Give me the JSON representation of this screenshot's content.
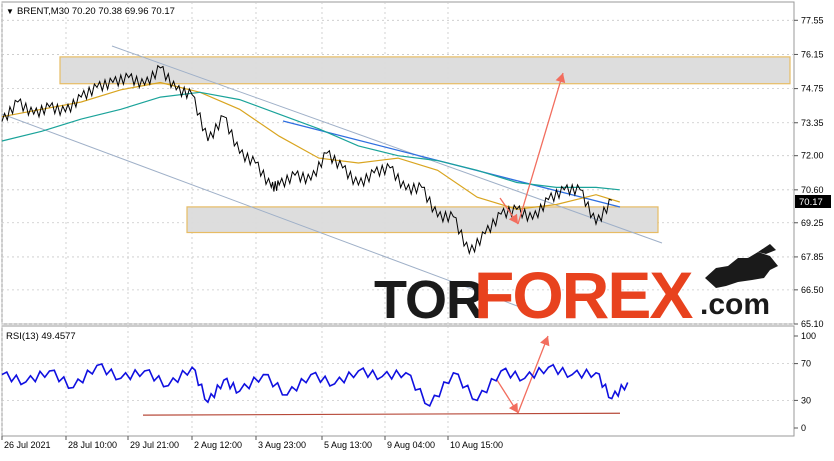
{
  "header": {
    "dropdown_glyph": "▼",
    "symbol_line": "BRENT,M30  70.20 70.38 69.96 70.17"
  },
  "rsi_label": "RSI(13) 49.4577",
  "watermark": {
    "part1": "TOR",
    "part2": "FOREX",
    "part3": ".com",
    "color_dark": "#1a1a1a",
    "color_accent": "#e8421e"
  },
  "colors": {
    "price": "#000000",
    "ma_fast": "#d9a520",
    "ma_slow": "#1aa39a",
    "channel": "#9fb0c8",
    "trend": "#2f6fe0",
    "zone_fill": "#dcdcdc",
    "zone_border": "#e6b95c",
    "arrow": "#f26d5e",
    "rsi": "#1010e0",
    "rsi_support": "#b74a3a",
    "grid": "#c8c8c8",
    "current_price_bg": "#000000"
  },
  "chart_data": [
    {
      "type": "line",
      "title": "BRENT,M30",
      "ohlc": {
        "open": 70.2,
        "high": 70.38,
        "low": 69.96,
        "close": 70.17
      },
      "current_price": "70.17",
      "ylim": [
        65.1,
        78.3
      ],
      "y_ticks": [
        "77.55",
        "76.15",
        "74.75",
        "73.35",
        "72.00",
        "70.60",
        "69.25",
        "67.85",
        "66.50",
        "65.10"
      ],
      "x_ticks": [
        "26 Jul 2021",
        "28 Jul 10:00",
        "29 Jul 21:00",
        "2 Aug 12:00",
        "3 Aug 23:00",
        "5 Aug 13:00",
        "9 Aug 04:00",
        "10 Aug 15:00"
      ],
      "x_range": [
        0,
        100
      ],
      "series": [
        {
          "name": "",
          "x": [
            0,
            2,
            4,
            6,
            8,
            10,
            12,
            14,
            16,
            18,
            20,
            22,
            24,
            26,
            28,
            30,
            32,
            34,
            35,
            37,
            39,
            41,
            43,
            45,
            47,
            49,
            51,
            53,
            55,
            57,
            59,
            61,
            63,
            65,
            67,
            69,
            71,
            73,
            75,
            77,
            79,
            81,
            82,
            84,
            86,
            88,
            90,
            92,
            94,
            96,
            98,
            100
          ],
          "y": [
            73.4,
            74.2,
            73.7,
            74.0,
            73.8,
            74.4,
            74.8,
            75.0,
            75.2,
            74.9,
            75.6,
            74.7,
            74.5,
            72.6,
            73.6,
            72.1,
            71.7,
            70.7,
            70.8,
            71.2,
            71.0,
            72.1,
            71.5,
            70.8,
            71.3,
            71.5,
            70.6,
            70.7,
            69.5,
            69.5,
            68.0,
            68.8,
            69.6,
            69.8,
            69.4,
            70.2,
            70.6,
            70.6,
            69.2,
            70.17,
            null,
            null,
            null,
            null,
            null,
            null,
            null,
            null,
            null,
            null,
            null,
            null
          ]
        },
        {
          "name": "",
          "x": [
            0,
            5,
            10,
            15,
            20,
            25,
            30,
            35,
            40,
            45,
            50,
            55,
            60,
            65,
            70,
            75,
            78
          ],
          "y": [
            73.6,
            73.9,
            74.2,
            74.7,
            75.0,
            74.6,
            73.9,
            72.8,
            71.9,
            71.7,
            71.9,
            71.4,
            70.3,
            69.8,
            70.0,
            70.4,
            70.1
          ]
        },
        {
          "name": "",
          "x": [
            0,
            5,
            10,
            15,
            20,
            25,
            30,
            35,
            40,
            45,
            50,
            55,
            60,
            65,
            70,
            75,
            78
          ],
          "y": [
            72.6,
            73.0,
            73.5,
            73.9,
            74.4,
            74.6,
            74.3,
            73.7,
            73.1,
            72.4,
            72.0,
            71.8,
            71.4,
            70.9,
            70.7,
            70.7,
            70.6
          ]
        }
      ],
      "zones": [
        {
          "y_low": 74.95,
          "y_high": 76.05
        },
        {
          "y_low": 68.85,
          "y_high": 69.9
        }
      ]
    },
    {
      "type": "line",
      "title": "RSI(13)",
      "value": 49.4577,
      "ylim": [
        0,
        100
      ],
      "y_ticks": [
        "100",
        "70",
        "30",
        "0"
      ],
      "series": [
        {
          "name": "",
          "x": [
            0,
            3,
            6,
            9,
            12,
            15,
            18,
            21,
            24,
            26,
            28,
            30,
            33,
            36,
            39,
            42,
            45,
            48,
            51,
            54,
            57,
            60,
            63,
            66,
            69,
            72,
            75,
            77,
            79
          ],
          "y": [
            58,
            50,
            62,
            44,
            68,
            54,
            62,
            46,
            66,
            28,
            52,
            40,
            58,
            36,
            58,
            48,
            62,
            56,
            60,
            24,
            60,
            30,
            62,
            54,
            66,
            58,
            60,
            32,
            49.46
          ]
        }
      ]
    }
  ]
}
